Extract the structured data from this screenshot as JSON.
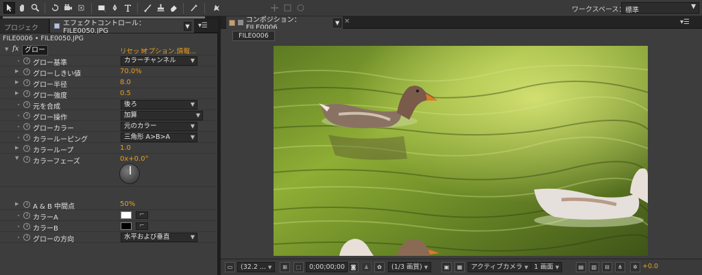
{
  "toolbar": {
    "workspace_label": "ワークスペース：",
    "workspace_value": "標準",
    "tools": [
      "selection-tool",
      "hand-tool",
      "zoom-tool",
      "rotate-tool",
      "camera-tool",
      "pan-behind-tool",
      "mask-tool",
      "pen-tool",
      "type-tool",
      "brush-tool",
      "clone-stamp-tool",
      "eraser-tool",
      "roto-brush-tool",
      "puppet-tool"
    ]
  },
  "left_panel": {
    "tab_project": "プロジェクト",
    "tab_effect": "エフェクトコントロール：FILE0050.JPG",
    "breadcrumb": "FILE0006 • FILE0050.JPG",
    "effect": {
      "fx_label": "fx",
      "name": "グロー",
      "reset": "リセット",
      "options": "オプション...",
      "info": "情報..."
    },
    "properties": [
      {
        "label": "グロー基準",
        "type": "select",
        "value": "カラーチャンネル"
      },
      {
        "label": "グローしきい値",
        "type": "value",
        "value": "70.0%"
      },
      {
        "label": "グロー半径",
        "type": "value",
        "value": "8.0"
      },
      {
        "label": "グロー強度",
        "type": "value",
        "value": "0.5"
      },
      {
        "label": "元を合成",
        "type": "select",
        "value": "後ろ"
      },
      {
        "label": "グロー操作",
        "type": "select",
        "value": "加算"
      },
      {
        "label": "グローカラー",
        "type": "select",
        "value": "元のカラー"
      },
      {
        "label": "カラールーピング",
        "type": "select",
        "value": "三角形 A>B>A"
      },
      {
        "label": "カラーループ",
        "type": "value",
        "value": "1.0"
      },
      {
        "label": "カラーフェーズ",
        "type": "value",
        "value": "0x+0.0°"
      },
      {
        "label": "A & B 中間点",
        "type": "value",
        "value": "50%"
      },
      {
        "label": "カラーA",
        "type": "color",
        "value": "#ffffff"
      },
      {
        "label": "カラーB",
        "type": "color",
        "value": "#000000"
      },
      {
        "label": "グローの方向",
        "type": "select",
        "value": "水平および垂直"
      }
    ]
  },
  "right_panel": {
    "tab_label": "コンポジション：FILE0006",
    "comp_name": "FILE0006",
    "bottom_bar": {
      "zoom": "(32.2 ...",
      "timecode": "0;00;00;00",
      "resolution": "(1/3 画質)",
      "camera": "アクティブカメラ",
      "views": "1 画面",
      "exposure": "+0.0"
    }
  },
  "colors": {
    "accent": "#e8a020",
    "panel": "#3d3d3d",
    "dark": "#232323"
  }
}
